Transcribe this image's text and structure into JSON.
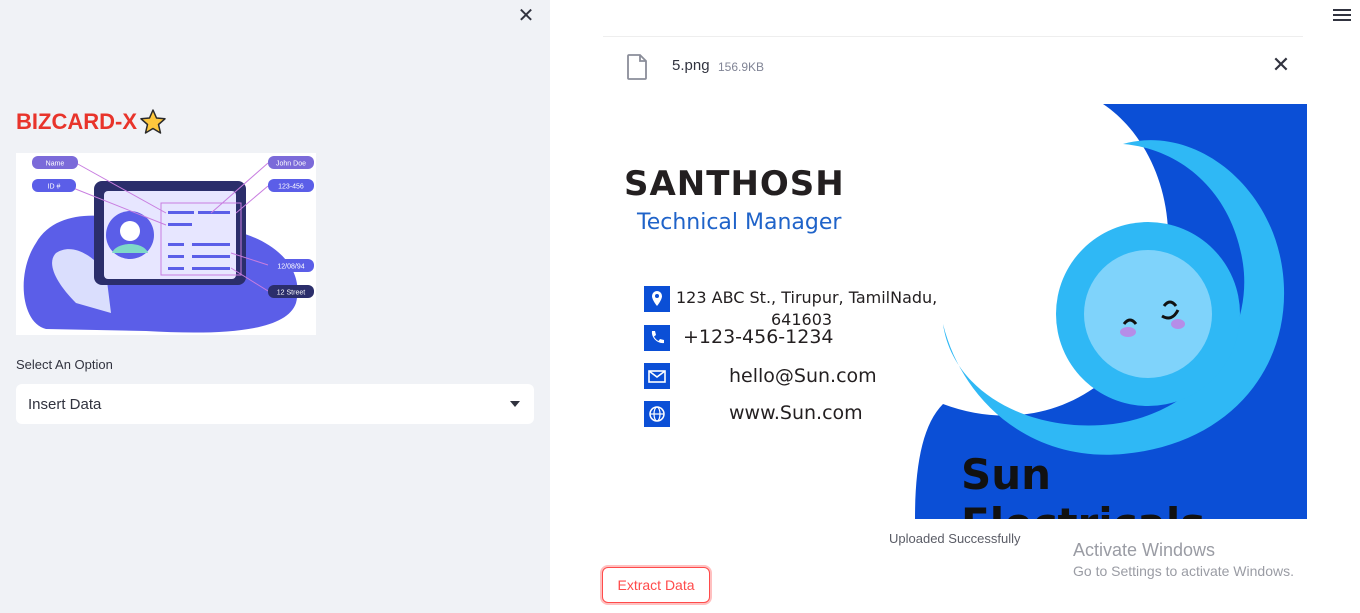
{
  "sidebar": {
    "brand": "BIZCARD-X",
    "select_label": "Select An Option",
    "select_value": "Insert Data",
    "illustration": {
      "tag_name": "Name",
      "tag_id": "ID #",
      "tag_person": "John Doe",
      "tag_number": "123-456",
      "tag_date": "12/08/94",
      "tag_street": "12 Street"
    }
  },
  "upload": {
    "file_name": "5.png",
    "file_size": "156.9KB",
    "status": "Uploaded Successfully",
    "extract_label": "Extract Data"
  },
  "card": {
    "name": "SANTHOSH",
    "role": "Technical Manager",
    "address_line1": "123 ABC St., Tirupur, TamilNadu,",
    "address_line2": "641603",
    "phone": "+123-456-1234",
    "email": "hello@Sun.com",
    "website": "www.Sun.com",
    "company": "Sun Electricals"
  },
  "watermark": {
    "title": "Activate Windows",
    "subtitle": "Go to Settings to activate Windows."
  },
  "colors": {
    "accent": "#ff4b4b",
    "brand_red": "#e8342b",
    "card_blue": "#0b4fd6",
    "sky_blue": "#2fb8f5"
  },
  "icons": [
    "close-icon",
    "star-icon",
    "chevron-down-icon",
    "hamburger-menu-icon",
    "file-icon",
    "location-icon",
    "phone-icon",
    "mail-icon",
    "globe-icon",
    "sun-icon"
  ]
}
